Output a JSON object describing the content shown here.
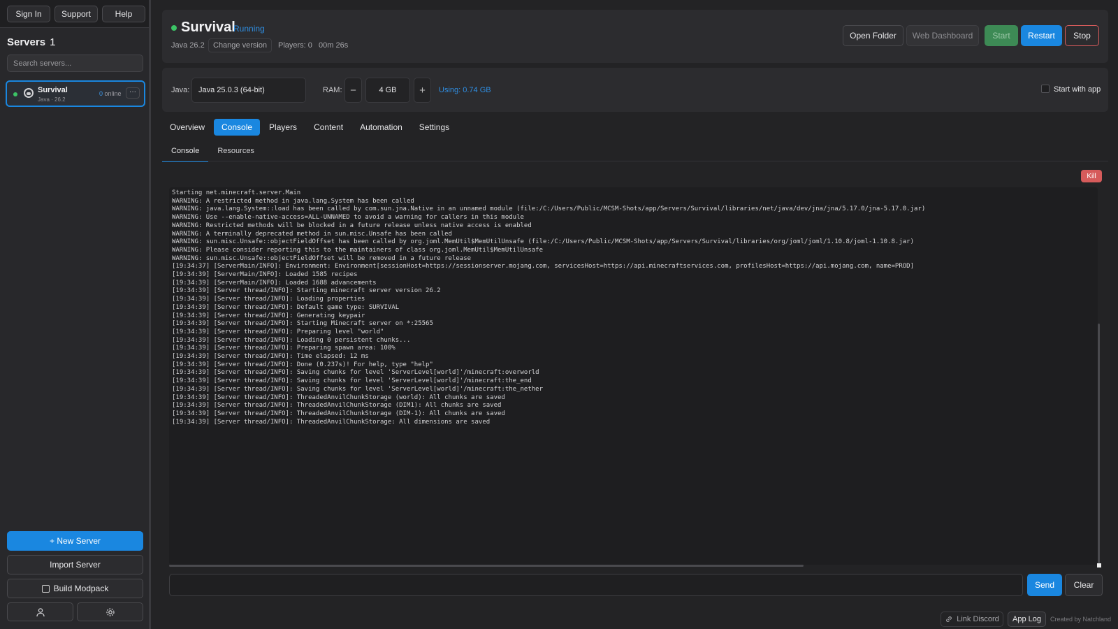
{
  "topnav": {
    "sign_in": "Sign In",
    "support": "Support",
    "help": "Help"
  },
  "sidebar": {
    "title": "Servers",
    "count": "1",
    "search_placeholder": "Search servers...",
    "servers": [
      {
        "name": "Survival",
        "sub": "Java · 26.2",
        "online_count": "0",
        "online_label": "online",
        "more": "···"
      }
    ],
    "new_server": "+ New Server",
    "import_server": "Import Server",
    "build_modpack": "Build Modpack"
  },
  "header": {
    "name": "Survival",
    "status": "Running",
    "java": "Java  26.2",
    "change_version": "Change version",
    "players": "Players: 0",
    "uptime": "00m 26s",
    "open_folder": "Open Folder",
    "web_dashboard": "Web Dashboard",
    "start": "Start",
    "restart": "Restart",
    "stop": "Stop"
  },
  "runtime": {
    "java_label": "Java:",
    "java_value": "Java 25.0.3 (64-bit)",
    "ram_label": "RAM:",
    "ram_minus": "−",
    "ram_value": "4 GB",
    "ram_plus": "+",
    "using": "Using: 0.74 GB",
    "start_with_app": "Start with app"
  },
  "tabs": [
    "Overview",
    "Console",
    "Players",
    "Content",
    "Automation",
    "Settings"
  ],
  "subtabs": [
    "Console",
    "Resources"
  ],
  "kill": "Kill",
  "console_lines": [
    "Starting net.minecraft.server.Main",
    "WARNING: A restricted method in java.lang.System has been called",
    "WARNING: java.lang.System::load has been called by com.sun.jna.Native in an unnamed module (file:/C:/Users/Public/MCSM-Shots/app/Servers/Survival/libraries/net/java/dev/jna/jna/5.17.0/jna-5.17.0.jar)",
    "WARNING: Use --enable-native-access=ALL-UNNAMED to avoid a warning for callers in this module",
    "WARNING: Restricted methods will be blocked in a future release unless native access is enabled",
    "",
    "WARNING: A terminally deprecated method in sun.misc.Unsafe has been called",
    "WARNING: sun.misc.Unsafe::objectFieldOffset has been called by org.joml.MemUtil$MemUtilUnsafe (file:/C:/Users/Public/MCSM-Shots/app/Servers/Survival/libraries/org/joml/joml/1.10.8/joml-1.10.8.jar)",
    "WARNING: Please consider reporting this to the maintainers of class org.joml.MemUtil$MemUtilUnsafe",
    "WARNING: sun.misc.Unsafe::objectFieldOffset will be removed in a future release",
    "[19:34:37] [ServerMain/INFO]: Environment: Environment[sessionHost=https://sessionserver.mojang.com, servicesHost=https://api.minecraftservices.com, profilesHost=https://api.mojang.com, name=PROD]",
    "[19:34:39] [ServerMain/INFO]: Loaded 1585 recipes",
    "[19:34:39] [ServerMain/INFO]: Loaded 1688 advancements",
    "[19:34:39] [Server thread/INFO]: Starting minecraft server version 26.2",
    "[19:34:39] [Server thread/INFO]: Loading properties",
    "[19:34:39] [Server thread/INFO]: Default game type: SURVIVAL",
    "[19:34:39] [Server thread/INFO]: Generating keypair",
    "[19:34:39] [Server thread/INFO]: Starting Minecraft server on *:25565",
    "[19:34:39] [Server thread/INFO]: Preparing level \"world\"",
    "[19:34:39] [Server thread/INFO]: Loading 0 persistent chunks...",
    "[19:34:39] [Server thread/INFO]: Preparing spawn area: 100%",
    "[19:34:39] [Server thread/INFO]: Time elapsed: 12 ms",
    "[19:34:39] [Server thread/INFO]: Done (0.237s)! For help, type \"help\"",
    "[19:34:39] [Server thread/INFO]: Saving chunks for level 'ServerLevel[world]'/minecraft:overworld",
    "[19:34:39] [Server thread/INFO]: Saving chunks for level 'ServerLevel[world]'/minecraft:the_end",
    "[19:34:39] [Server thread/INFO]: Saving chunks for level 'ServerLevel[world]'/minecraft:the_nether",
    "[19:34:39] [Server thread/INFO]: ThreadedAnvilChunkStorage (world): All chunks are saved",
    "[19:34:39] [Server thread/INFO]: ThreadedAnvilChunkStorage (DIM1): All chunks are saved",
    "[19:34:39] [Server thread/INFO]: ThreadedAnvilChunkStorage (DIM-1): All chunks are saved",
    "[19:34:39] [Server thread/INFO]: ThreadedAnvilChunkStorage: All dimensions are saved"
  ],
  "command": {
    "value": "",
    "send": "Send",
    "clear": "Clear"
  },
  "footer": {
    "link_discord": "Link Discord",
    "app_log": "App Log",
    "credit": "Created by Natchland"
  },
  "colors": {
    "accent": "#1a87e0",
    "running": "#3cc466",
    "danger": "#d65b5b",
    "start_green": "#3d8a55"
  }
}
